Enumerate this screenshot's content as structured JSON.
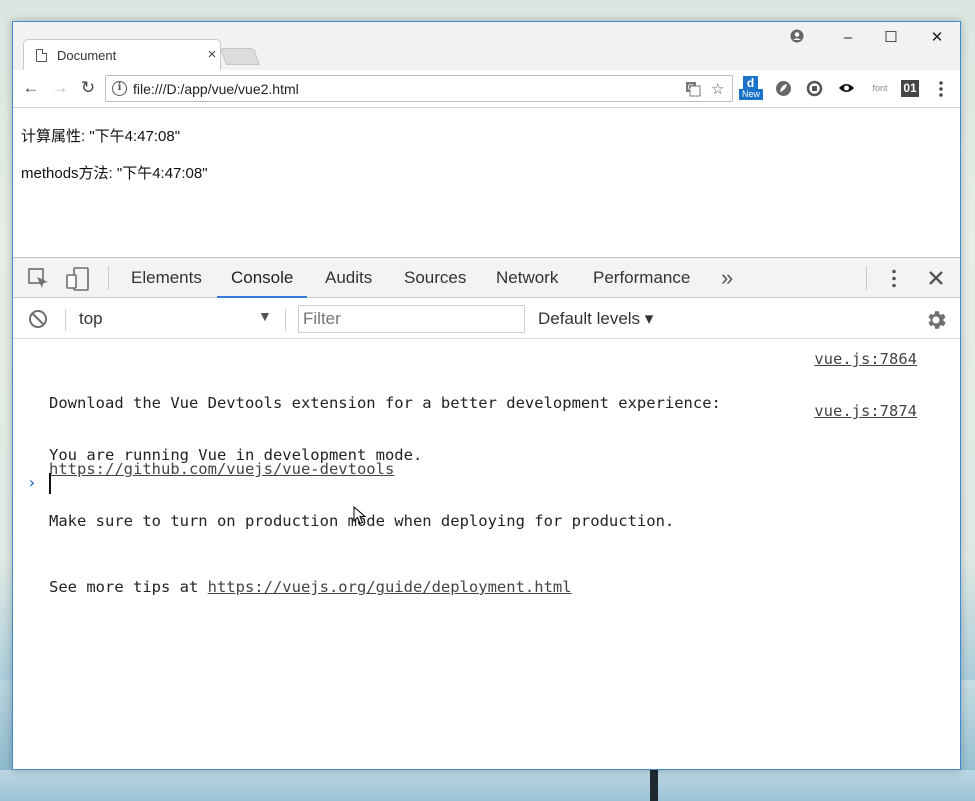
{
  "browser": {
    "tab_title": "Document",
    "tab_close": "×",
    "url": "file:///D:/app/vue/vue2.html",
    "window_buttons": {
      "minimize": "–",
      "maximize": "☐",
      "close": "✕"
    },
    "nav": {
      "back": "←",
      "forward": "→",
      "reload": "↻"
    },
    "extensions": {
      "new_badge": "New",
      "font_label": "font",
      "binary_label": "01"
    }
  },
  "page": {
    "line1": "计算属性: \"下午4:47:08\"",
    "line2": "methods方法: \"下午4:47:08\""
  },
  "devtools": {
    "tabs": [
      "Elements",
      "Console",
      "Audits",
      "Sources",
      "Network",
      "Performance"
    ],
    "active_tab": "Console",
    "more_tabs": "»",
    "context": "top",
    "filter_placeholder": "Filter",
    "levels": "Default levels",
    "messages": [
      {
        "text": "Download the Vue Devtools extension for a better development experience:",
        "link": "https://github.com/vuejs/vue-devtools",
        "source": "vue.js:7864"
      },
      {
        "line1": "You are running Vue in development mode.",
        "line2": "Make sure to turn on production mode when deploying for production.",
        "line3_prefix": "See more tips at ",
        "link": "https://vuejs.org/guide/deployment.html",
        "source": "vue.js:7874"
      }
    ],
    "prompt": "›"
  }
}
